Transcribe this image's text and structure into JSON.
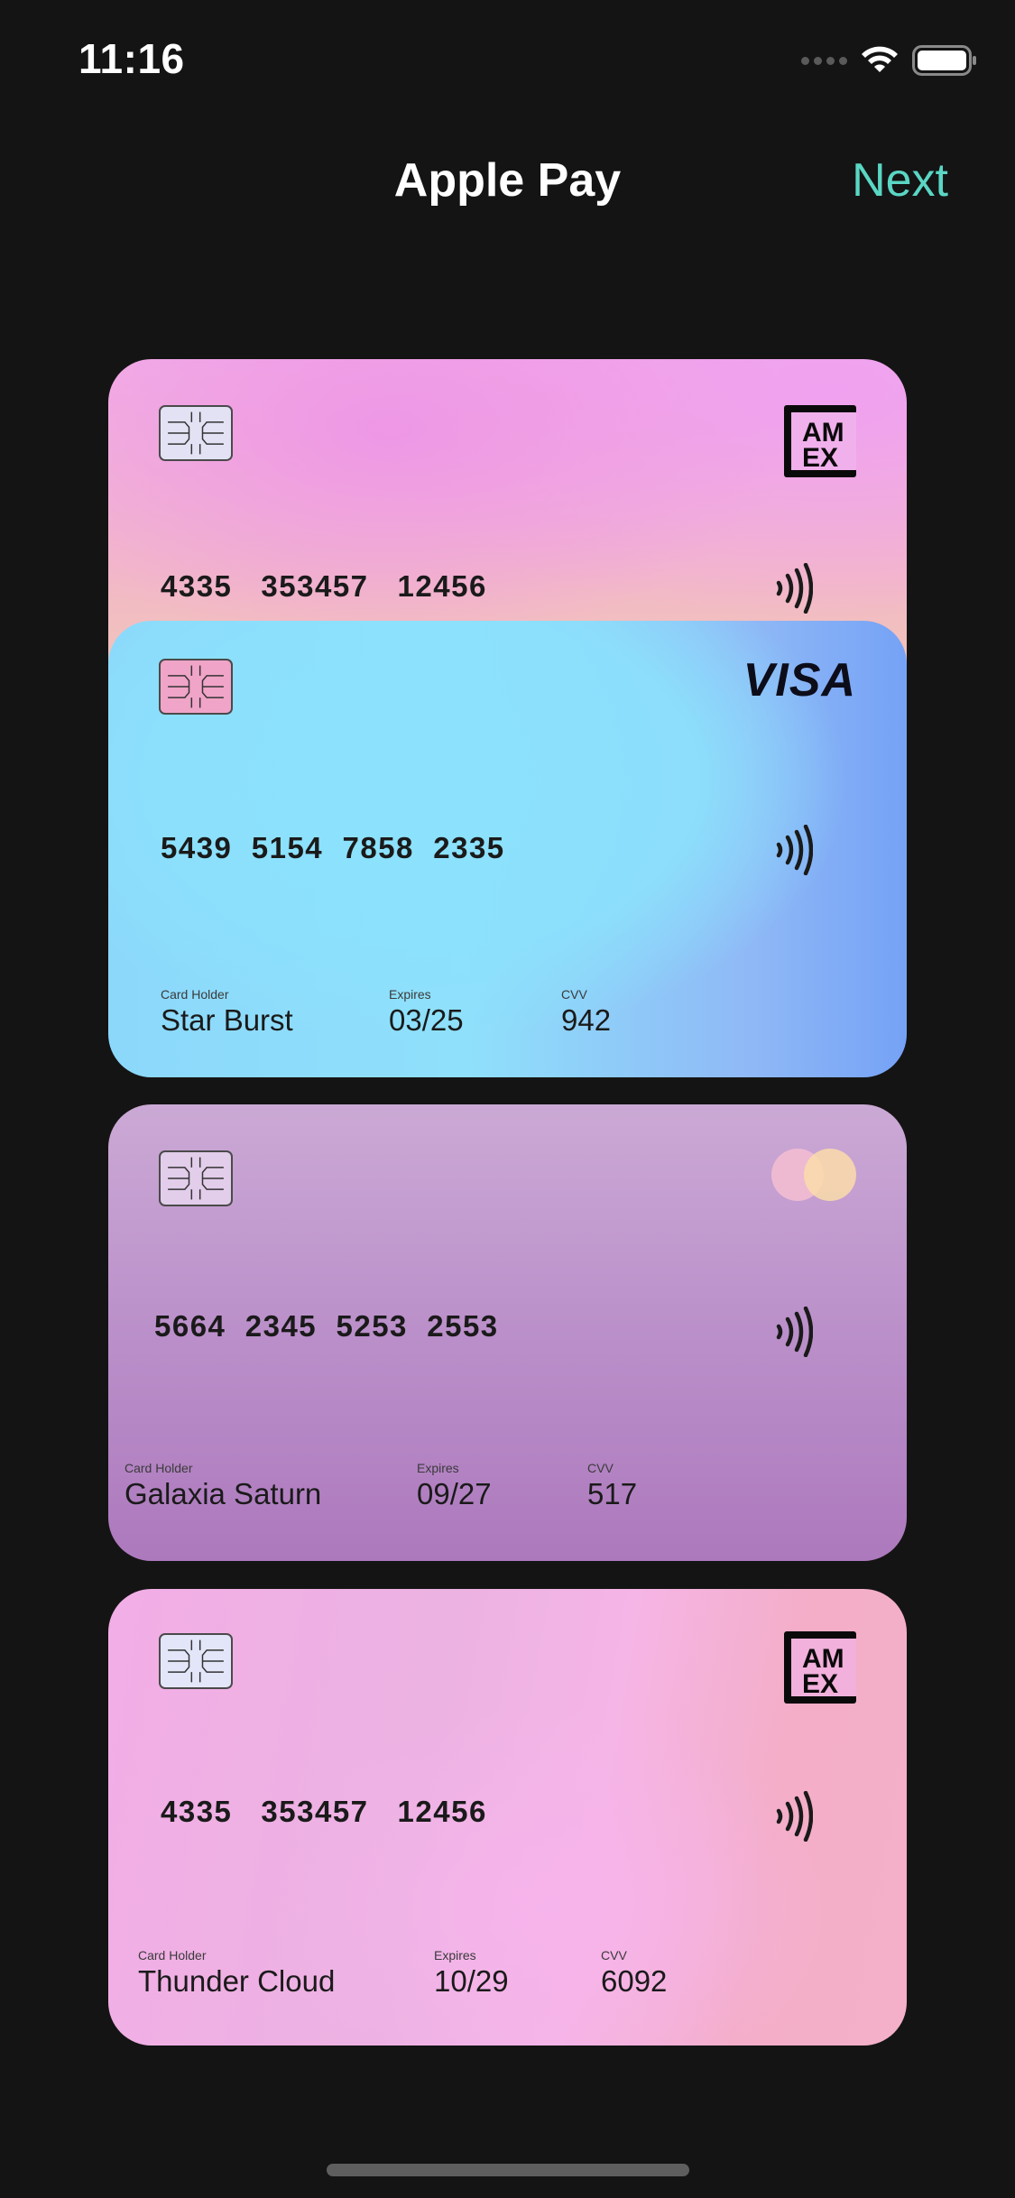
{
  "status_bar": {
    "time": "11:16"
  },
  "nav": {
    "title": "Apple Pay",
    "next_label": "Next"
  },
  "colors": {
    "background": "#141414",
    "accent": "#5ad6c4"
  },
  "cards": [
    {
      "brand": "amex",
      "number": "4335   353457   12456"
    },
    {
      "brand": "visa",
      "brand_text": "VISA",
      "number": "5439  5154  7858  2335",
      "holder_label": "Card Holder",
      "holder": "Star Burst",
      "expires_label": "Expires",
      "expires": "03/25",
      "cvv_label": "CVV",
      "cvv": "942"
    },
    {
      "brand": "mastercard",
      "number": "5664  2345  5253  2553",
      "holder_label": "Card Holder",
      "holder": "Galaxia Saturn",
      "expires_label": "Expires",
      "expires": "09/27",
      "cvv_label": "CVV",
      "cvv": "517"
    },
    {
      "brand": "amex",
      "number": "4335   353457   12456",
      "holder_label": "Card Holder",
      "holder": "Thunder Cloud",
      "expires_label": "Expires",
      "expires": "10/29",
      "cvv_label": "CVV",
      "cvv": "6092"
    }
  ],
  "icons": [
    "cellular-signal-icon",
    "wifi-icon",
    "battery-icon",
    "chip-icon",
    "contactless-icon",
    "amex-logo-icon",
    "visa-logo",
    "mastercard-logo-icon"
  ]
}
